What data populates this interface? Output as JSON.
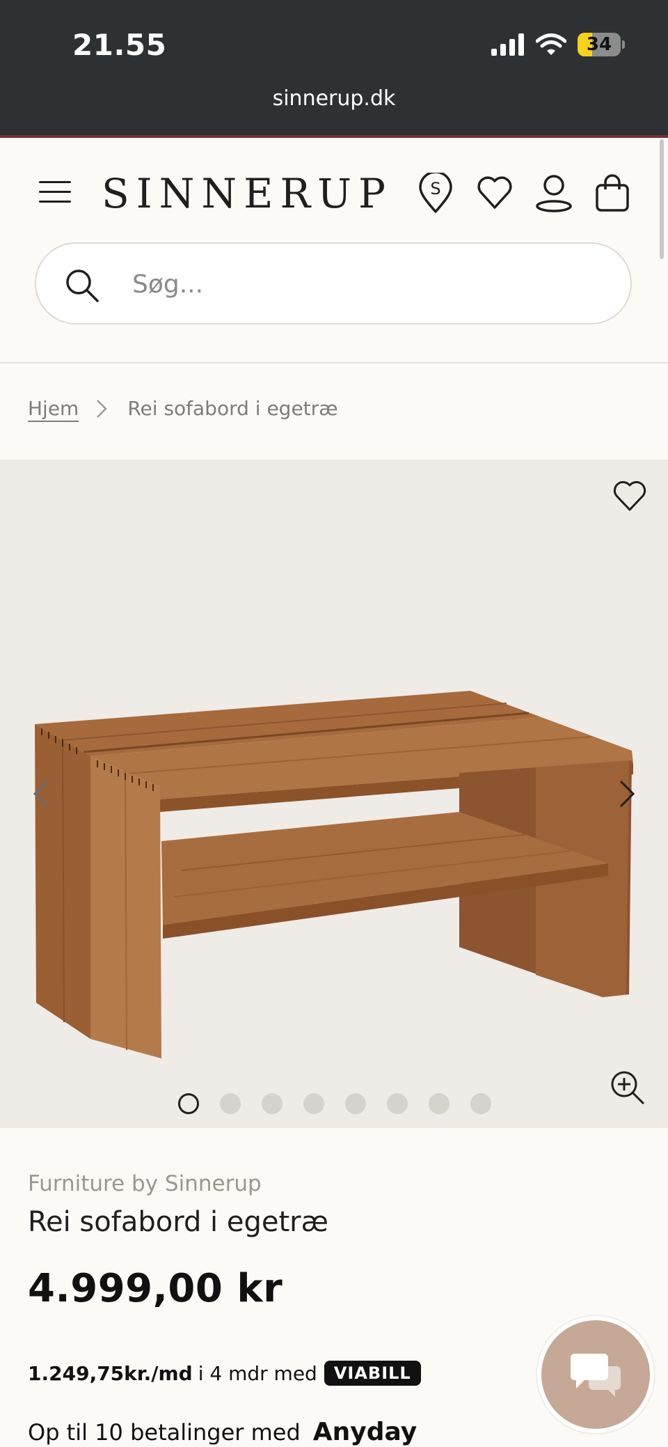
{
  "status_bar": {
    "time": "21.55",
    "battery": {
      "label": "34",
      "level_percent": 34
    },
    "icons": [
      "signal-icon",
      "wifi-icon",
      "battery-icon"
    ],
    "url": "sinnerup.dk"
  },
  "header": {
    "logo_text": "SINNERUP",
    "icons": [
      "menu-icon",
      "store-locator-icon",
      "wishlist-icon",
      "account-icon",
      "bag-icon"
    ],
    "search": {
      "placeholder": "Søg...",
      "value": ""
    }
  },
  "breadcrumb": {
    "home": "Hjem",
    "current": "Rei sofabord i egetræ"
  },
  "gallery": {
    "image_count": 8,
    "active_index": 0,
    "icons": [
      "heart-icon",
      "chevron-left-icon",
      "chevron-right-icon",
      "zoom-in-icon"
    ]
  },
  "product": {
    "brand": "Furniture by Sinnerup",
    "title": "Rei sofabord i egetræ",
    "price": "4.999,00 kr",
    "installment": {
      "amount": "1.249,75kr./md",
      "text": "i 4 mdr med",
      "provider": "VIABILL"
    },
    "anyday": {
      "text": "Op til 10 betalinger med",
      "provider": "Anyday"
    }
  },
  "colors": {
    "status_bar_bg": "#2e3134",
    "page_bg": "#fcfaf7",
    "gallery_bg": "#efebe7",
    "chat_button": "#c5a895",
    "battery_fill": "#f6d21c"
  }
}
